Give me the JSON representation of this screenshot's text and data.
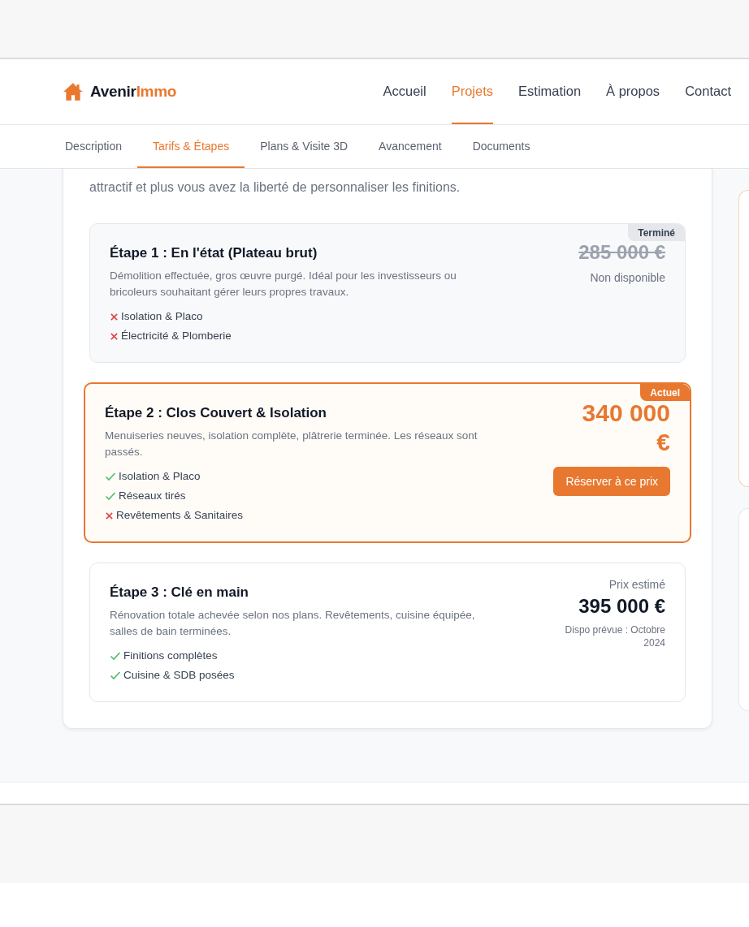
{
  "brand": {
    "part_1": "Avenir",
    "part_2": "Immo"
  },
  "nav": [
    {
      "label": "Accueil",
      "selected": false
    },
    {
      "label": "Projets",
      "selected": true
    },
    {
      "label": "Estimation",
      "selected": false
    },
    {
      "label": "À propos",
      "selected": false
    },
    {
      "label": "Contact",
      "selected": false
    }
  ],
  "tabs": [
    {
      "label": "Description",
      "selected": false
    },
    {
      "label": "Tarifs & Étapes",
      "selected": true
    },
    {
      "label": "Plans & Visite 3D",
      "selected": false
    },
    {
      "label": "Avancement",
      "selected": false
    },
    {
      "label": "Documents",
      "selected": false
    }
  ],
  "intro": "attractif et plus vous avez la liberté de personnaliser les finitions.",
  "stages": [
    {
      "kind": "done",
      "badge": "Terminé",
      "title": "Étape 1 : En l'état (Plateau brut)",
      "description": "Démolition effectuée, gros œuvre purgé. Idéal pour les investisseurs ou bricoleurs souhaitant gérer leurs propres travaux.",
      "features": [
        {
          "label": "Isolation & Placo",
          "included": false
        },
        {
          "label": "Électricité & Plomberie",
          "included": false
        }
      ],
      "price": "285 000 €",
      "note": "Non disponible"
    },
    {
      "kind": "current",
      "badge": "Actuel",
      "title": "Étape 2 : Clos Couvert & Isolation",
      "description": "Menuiseries neuves, isolation complète, plâtrerie terminée. Les réseaux sont passés.",
      "features": [
        {
          "label": "Isolation & Placo",
          "included": true
        },
        {
          "label": "Réseaux tirés",
          "included": true
        },
        {
          "label": "Revêtements & Sanitaires",
          "included": false
        }
      ],
      "price": "340 000 €",
      "button": "Réserver à ce prix"
    },
    {
      "kind": "upcoming",
      "title": "Étape 3 : Clé en main",
      "description": "Rénovation totale achevée selon nos plans. Revêtements, cuisine équipée, salles de bain terminées.",
      "features": [
        {
          "label": "Finitions complètes",
          "included": true
        },
        {
          "label": "Cuisine & SDB posées",
          "included": true
        }
      ],
      "price_label": "Prix estimé",
      "price": "395 000 €",
      "note": "Dispo prévue : Octobre 2024"
    }
  ]
}
